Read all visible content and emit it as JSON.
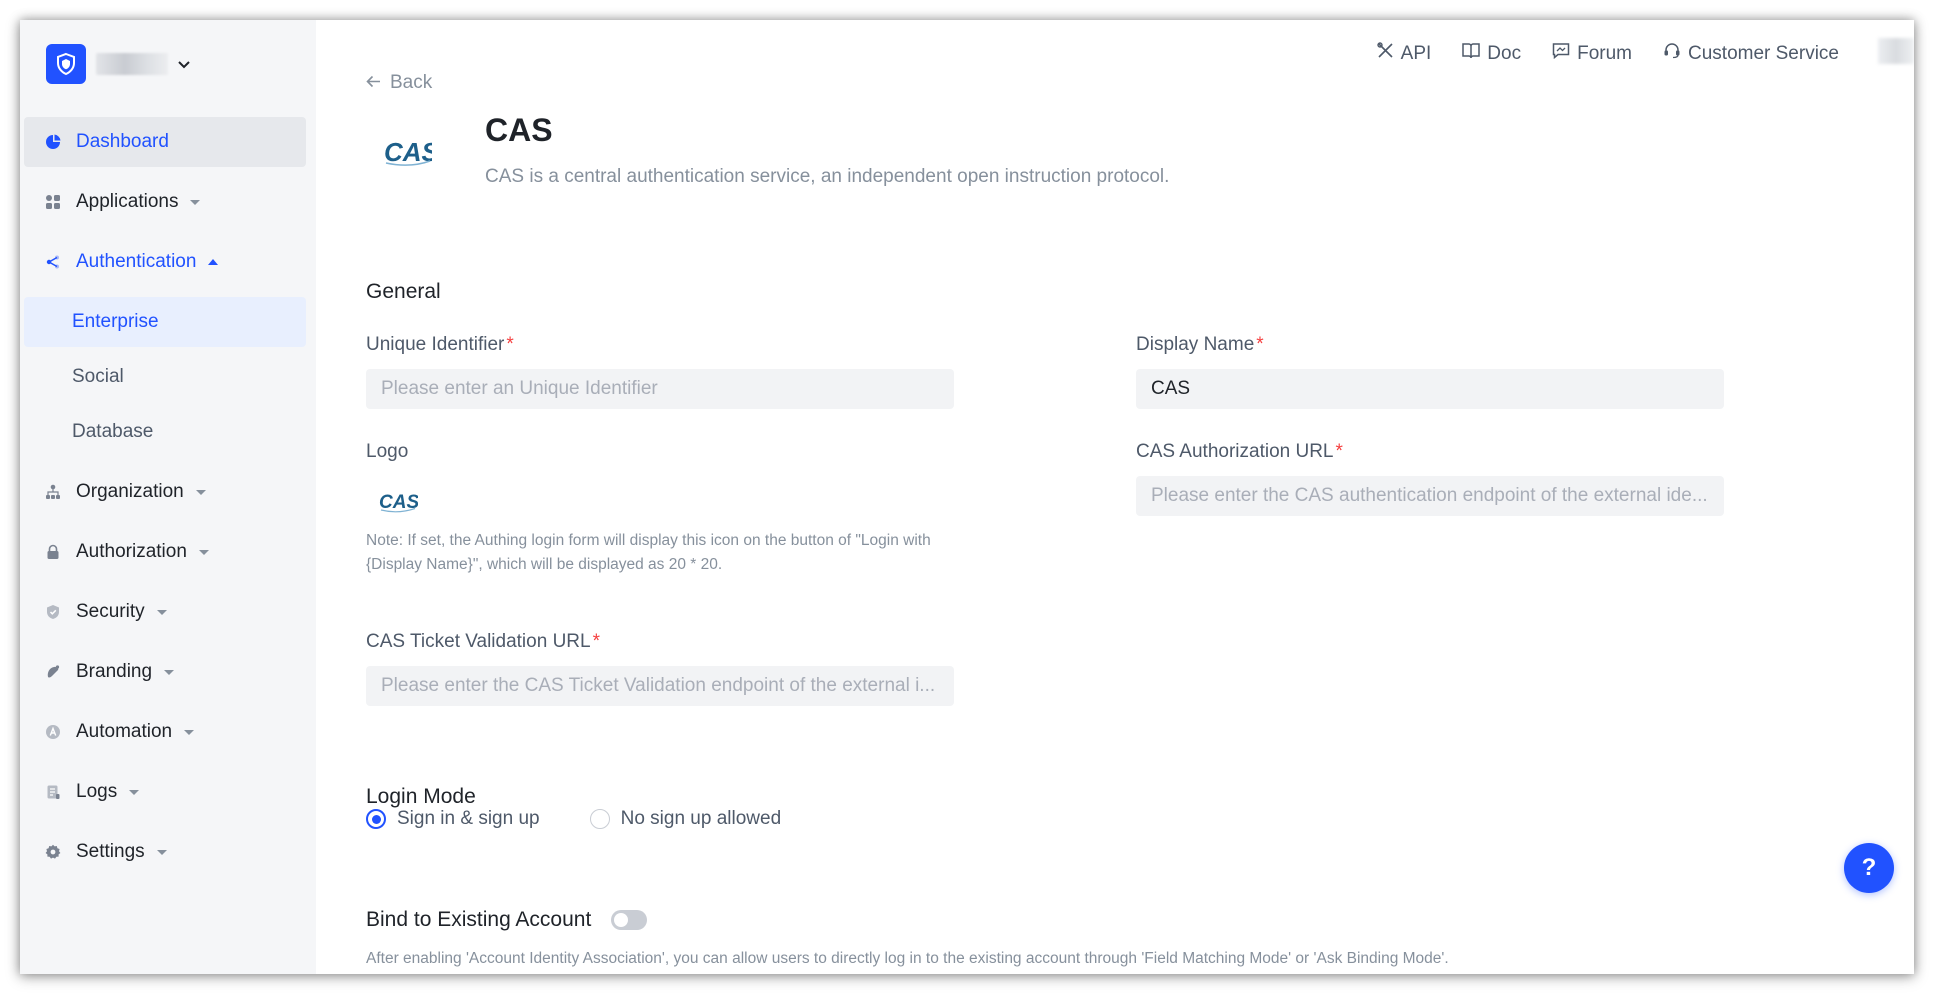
{
  "colors": {
    "accent": "#2152ff",
    "required": "#f53f3f",
    "cas_logo": "#1d5f8a"
  },
  "sidebar": {
    "items": [
      {
        "label": "Dashboard",
        "icon": "pie-chart-icon"
      },
      {
        "label": "Applications",
        "icon": "apps-grid-icon"
      },
      {
        "label": "Authentication",
        "icon": "share-node-icon"
      },
      {
        "label": "Enterprise"
      },
      {
        "label": "Social"
      },
      {
        "label": "Database"
      },
      {
        "label": "Organization",
        "icon": "org-tree-icon"
      },
      {
        "label": "Authorization",
        "icon": "lock-icon"
      },
      {
        "label": "Security",
        "icon": "shield-icon"
      },
      {
        "label": "Branding",
        "icon": "palette-icon"
      },
      {
        "label": "Automation",
        "icon": "automation-icon"
      },
      {
        "label": "Logs",
        "icon": "document-icon"
      },
      {
        "label": "Settings",
        "icon": "gear-icon"
      }
    ]
  },
  "topbar": {
    "api": "API",
    "doc": "Doc",
    "forum": "Forum",
    "customer_service": "Customer Service"
  },
  "header": {
    "back": "Back",
    "logo_text": "CAS",
    "title": "CAS",
    "description": "CAS is a central authentication service, an independent open instruction protocol."
  },
  "general": {
    "section_title": "General",
    "unique_identifier": {
      "label": "Unique Identifier",
      "required": "*",
      "value": "",
      "placeholder": "Please enter an Unique Identifier"
    },
    "display_name": {
      "label": "Display Name",
      "required": "*",
      "value": "CAS"
    },
    "logo": {
      "label": "Logo",
      "logo_text": "CAS"
    },
    "logo_note": "Note: If set, the Authing login form will display this icon on the button of \"Login with {Display Name}\", which will be displayed as 20 * 20.",
    "cas_auth_url": {
      "label": "CAS Authorization URL",
      "required": "*",
      "value": "",
      "placeholder": "Please enter the CAS authentication endpoint of the external ide..."
    },
    "cas_ticket_url": {
      "label": "CAS Ticket Validation URL",
      "required": "*",
      "value": "",
      "placeholder": "Please enter the CAS Ticket Validation endpoint of the external i..."
    }
  },
  "login_mode": {
    "title": "Login Mode",
    "options": [
      "Sign in & sign up",
      "No sign up allowed"
    ],
    "selected": "Sign in & sign up"
  },
  "bind_account": {
    "label": "Bind to Existing Account",
    "enabled": false,
    "description": "After enabling 'Account Identity Association', you can allow users to directly log in to the existing account through 'Field Matching Mode' or 'Ask Binding Mode'."
  },
  "help_button": "?"
}
